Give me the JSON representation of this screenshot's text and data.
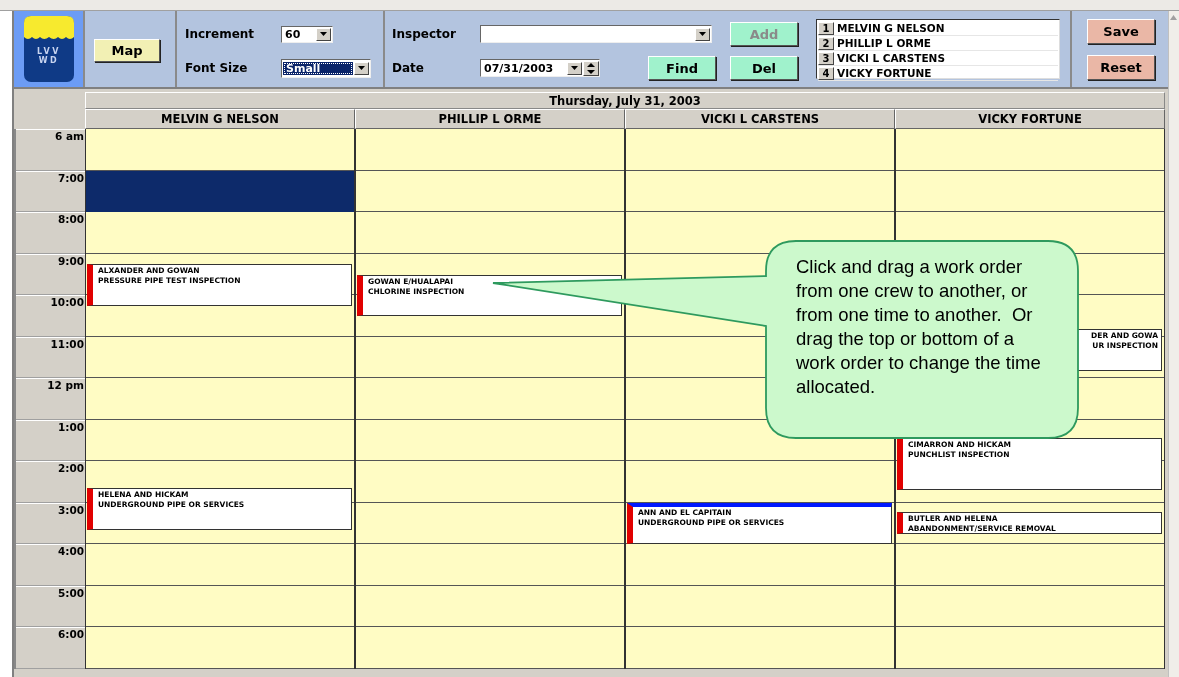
{
  "logo": {
    "lines": [
      "LVV",
      "WD"
    ]
  },
  "toolbar": {
    "map_button": "Map",
    "increment": {
      "label": "Increment",
      "value": "60"
    },
    "font_size": {
      "label": "Font Size",
      "value": "Small",
      "focused": true
    },
    "inspector": {
      "label": "Inspector"
    },
    "date": {
      "label": "Date",
      "value": "07/31/2003"
    },
    "buttons": [
      {
        "label": "Add",
        "disabled": true
      },
      {
        "label": "Find",
        "disabled": false
      },
      {
        "label": "Del",
        "disabled": false
      }
    ],
    "inspector_list": [
      {
        "number": "1",
        "name": "MELVIN G NELSON"
      },
      {
        "number": "2",
        "name": "PHILLIP L ORME"
      },
      {
        "number": "3",
        "name": "VICKI L CARSTENS"
      },
      {
        "number": "4",
        "name": "VICKY FORTUNE"
      }
    ],
    "actions": [
      "Save",
      "Reset"
    ]
  },
  "schedule": {
    "date_heading": "Thursday, July 31, 2003",
    "times": [
      "6 am",
      "7:00",
      "8:00",
      "9:00",
      "10:00",
      "11:00",
      "12 pm",
      "1:00",
      "2:00",
      "3:00",
      "4:00",
      "5:00",
      "6:00"
    ],
    "columns": [
      {
        "name": "MELVIN G NELSON",
        "events": [
          {
            "kind": "selection"
          },
          {
            "kind": "work-order",
            "title": "ALXANDER AND GOWAN",
            "type": "PRESSURE PIPE TEST INSPECTION",
            "selected": false,
            "cut_left": false
          },
          {
            "kind": "work-order",
            "title": "HELENA AND HICKAM",
            "type": "UNDERGROUND PIPE OR SERVICES",
            "selected": false,
            "cut_left": false
          }
        ]
      },
      {
        "name": "PHILLIP L ORME",
        "events": [
          {
            "kind": "work-order",
            "title": "GOWAN E/HUALAPAI",
            "type": "CHLORINE INSPECTION",
            "selected": false,
            "cut_left": false
          }
        ]
      },
      {
        "name": "VICKI L CARSTENS",
        "events": [
          {
            "kind": "work-order",
            "title": "ANN AND EL CAPITAIN",
            "type": "UNDERGROUND PIPE OR SERVICES",
            "selected": true,
            "cut_left": false
          }
        ]
      },
      {
        "name": "VICKY FORTUNE",
        "events": [
          {
            "kind": "work-order",
            "title": "DER AND GOWA",
            "type": "UR INSPECTION",
            "selected": false,
            "cut_left": true
          },
          {
            "kind": "work-order",
            "title": "CIMARRON AND HICKAM",
            "type": "PUNCHLIST INSPECTION",
            "selected": false,
            "cut_left": false
          },
          {
            "kind": "work-order",
            "title": "BUTLER AND HELENA",
            "type": "ABANDONMENT/SERVICE REMOVAL",
            "selected": false,
            "cut_left": false
          }
        ]
      }
    ]
  },
  "callout": {
    "text": "Click and drag a work order from one crew to another, or from one time to another.  Or drag the top or bottom of a work order to change the time allocated."
  }
}
